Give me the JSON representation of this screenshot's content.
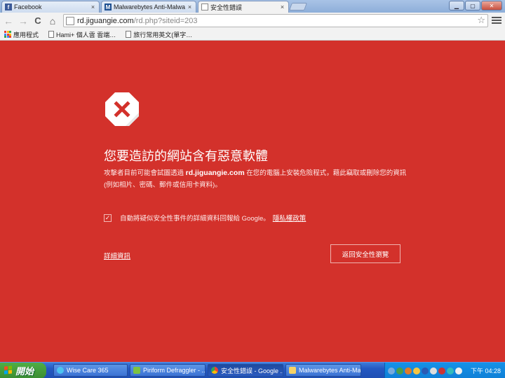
{
  "tabs": [
    {
      "label": "Facebook",
      "icon": "facebook-icon",
      "close": "×"
    },
    {
      "label": "Malwarebytes Anti-Malware",
      "icon": "malwarebytes-icon",
      "close": "×"
    },
    {
      "label": "安全性錯誤",
      "icon": "page-icon",
      "close": "×",
      "active": true
    }
  ],
  "window_controls": {
    "minimize": "▁",
    "maximize": "▢",
    "close": "✕"
  },
  "toolbar": {
    "back": "←",
    "forward": "→",
    "reload": "C",
    "home": "⌂",
    "url_host": "rd.jiguangie.com",
    "url_path": "/rd.php?siteid=203",
    "star": "☆"
  },
  "bookmarks": [
    {
      "label": "應用程式",
      "icon": "apps-icon"
    },
    {
      "label": "Hami+ 個人雲 雲端…",
      "icon": "doc-icon"
    },
    {
      "label": "旅行常用英文(單字…",
      "icon": "doc-icon"
    }
  ],
  "interstitial": {
    "headline": "您要造訪的網站含有惡意軟體",
    "desc_pre": "攻擊者目前可能會試圖透過 ",
    "desc_host": "rd.jiguangie.com",
    "desc_post": " 在您的電腦上安裝危險程式，藉此竊取或刪除您的資訊 (例如相片、密碼、郵件或信用卡資料)。",
    "checkbox_mark": "✓",
    "checkbox_label": "自動將疑似安全性事件的詳細資料回報給 Google。",
    "privacy_link": "隱私權政策",
    "details_link": "詳細資訊",
    "back_button": "返回安全性瀏覽",
    "accent_color": "#d3312b"
  },
  "taskbar": {
    "start_label": "開始",
    "tasks": [
      {
        "label": "Wise Care 365",
        "icon": "wise-care-icon"
      },
      {
        "label": "Piriform Defraggler - ...",
        "icon": "defraggler-icon"
      },
      {
        "label": "安全性錯誤 - Google ...",
        "icon": "chrome-icon",
        "active": true
      },
      {
        "label": "Malwarebytes Anti-Ma...",
        "icon": "folder-icon"
      }
    ],
    "clock": "下午 04:28"
  }
}
